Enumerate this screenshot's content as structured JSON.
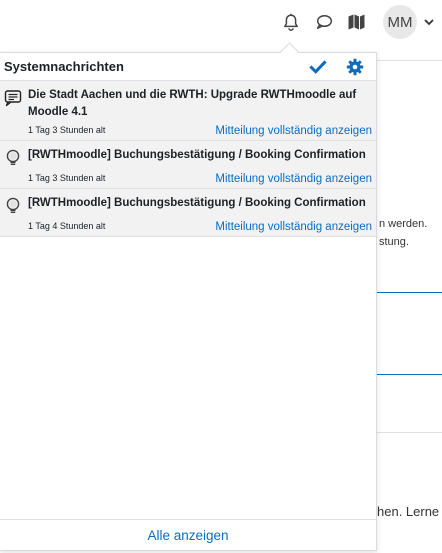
{
  "navbar": {
    "icons": {
      "notifications": "bell-icon",
      "messages": "chat-bubble-icon",
      "map": "map-icon"
    },
    "user_initials": "MM"
  },
  "background": {
    "line1": "n werden.",
    "line2": "stung.",
    "line3": "hen. Lerne"
  },
  "popover": {
    "title": "Systemnachrichten",
    "mark_all_read_icon": "checkmark-icon",
    "settings_icon": "gear-icon",
    "notifications": [
      {
        "icon": "message-icon",
        "subject": "Die Stadt Aachen und die RWTH: Upgrade RWTHmoodle auf Moodle 4.1",
        "time": "1 Tag 3 Stunden alt",
        "link": "Mitteilung vollständig anzeigen"
      },
      {
        "icon": "lightbulb-icon",
        "subject": "[RWTHmoodle] Buchungsbestätigung / Booking Confirmation",
        "time": "1 Tag 3 Stunden alt",
        "link": "Mitteilung vollständig anzeigen"
      },
      {
        "icon": "lightbulb-icon",
        "subject": "[RWTHmoodle] Buchungsbestätigung / Booking Confirmation",
        "time": "1 Tag 4 Stunden alt",
        "link": "Mitteilung vollständig anzeigen"
      }
    ],
    "footer_link": "Alle anzeigen"
  },
  "colors": {
    "link": "#0f6cbf",
    "unread_background": "#f2f2f2"
  }
}
